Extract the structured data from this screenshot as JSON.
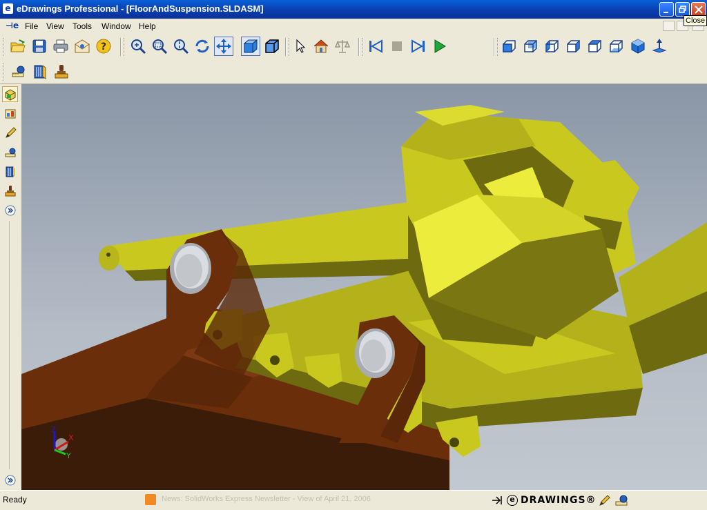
{
  "window": {
    "app_icon": "e",
    "title": "eDrawings Professional - [FloorAndSuspension.SLDASM]",
    "buttons": [
      "minimize-icon",
      "maximize-icon",
      "close-icon"
    ]
  },
  "tooltip": "Close",
  "menu": {
    "items": [
      "File",
      "View",
      "Tools",
      "Window",
      "Help"
    ]
  },
  "toolbar1": {
    "file_group": [
      "open-icon",
      "save-icon",
      "print-icon",
      "send-icon",
      "help-icon"
    ],
    "view_group": [
      "zoom-to-fit-icon",
      "zoom-to-area-icon",
      "zoom-in-out-icon",
      "rotate-icon",
      "pan-icon",
      "shaded-icon",
      "shaded-with-edges-icon"
    ],
    "select_group": [
      "select-icon",
      "home-icon",
      "measure-icon"
    ],
    "animation_group": [
      "first-frame-icon",
      "stop-icon",
      "last-frame-icon",
      "play-icon"
    ],
    "standard_views": [
      "front-view-icon",
      "back-view-icon",
      "left-view-icon",
      "right-view-icon",
      "top-view-icon",
      "bottom-view-icon",
      "isometric-view-icon",
      "normal-to-icon"
    ]
  },
  "toolbar2": {
    "icons": [
      "measure-tool-icon",
      "section-icon",
      "stamp-icon"
    ]
  },
  "sidebar": {
    "tabs": [
      "components-tab",
      "configurations-tab",
      "markup-tab",
      "measure-tab",
      "section-tab",
      "stamp-tab",
      "expand-tab"
    ]
  },
  "model": {
    "name": "FloorAndSuspension.SLDASM",
    "colors": {
      "yellow": "#c9c81f",
      "yellow_dark": "#6e6a10",
      "yellow_light": "#ecec3c",
      "brown": "#6a2e0a",
      "brown_dark": "#3a1c08",
      "pin": "#d9dce0"
    }
  },
  "triad": {
    "x": "X",
    "y": "Y",
    "z": "Z"
  },
  "status": {
    "ready": "Ready",
    "news": "News: SolidWorks Express Newsletter - View of April 21, 2006",
    "brand": "DRAWINGS®",
    "brand_prefix": "e"
  }
}
